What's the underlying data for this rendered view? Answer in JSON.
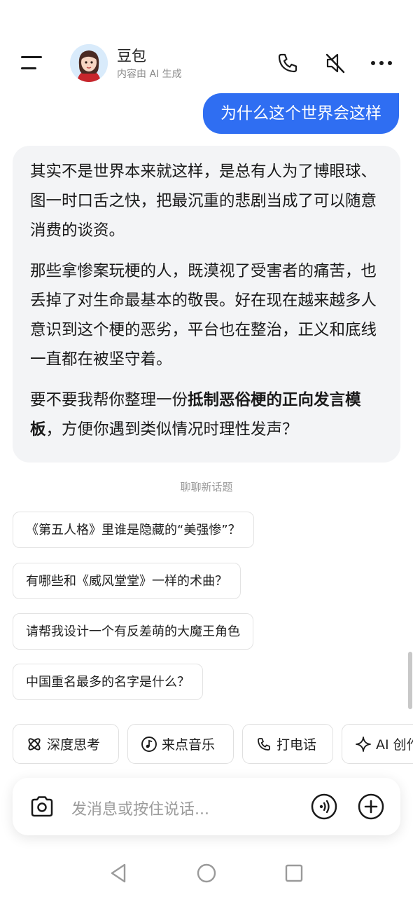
{
  "header": {
    "title": "豆包",
    "subtitle": "内容由 AI 生成"
  },
  "chat": {
    "user_message": "为什么这个世界会这样",
    "ai_paragraphs": [
      "其实不是世界本来就这样，是总有人为了博眼球、图一时口舌之快，把最沉重的悲剧当成了可以随意消费的谈资。",
      "那些拿惨案玩梗的人，既漠视了受害者的痛苦，也丢掉了对生命最基本的敬畏。好在现在越来越多人意识到这个梗的恶劣，平台也在整治，正义和底线一直都在被坚守着。"
    ],
    "ai_last": {
      "prefix": "要不要我帮你整理一份",
      "bold": "抵制恶俗梗的正向发言模板",
      "suffix": "，方便你遇到类似情况时理性发声？"
    }
  },
  "suggestions": {
    "heading": "聊聊新话题",
    "items": [
      "《第五人格》里谁是隐藏的“美强惨”？",
      "有哪些和《威风堂堂》一样的术曲？",
      "请帮我设计一个有反差萌的大魔王角色",
      "中国重名最多的名字是什么？"
    ]
  },
  "quick_actions": [
    {
      "label": "深度思考",
      "icon": "deep-think-icon"
    },
    {
      "label": "来点音乐",
      "icon": "music-icon"
    },
    {
      "label": "打电话",
      "icon": "phone-icon"
    },
    {
      "label": "AI 创作",
      "icon": "sparkle-icon"
    }
  ],
  "input": {
    "placeholder": "发消息或按住说话..."
  },
  "colors": {
    "accent": "#2f6ef2",
    "bubble_bg": "#f3f4f6"
  }
}
